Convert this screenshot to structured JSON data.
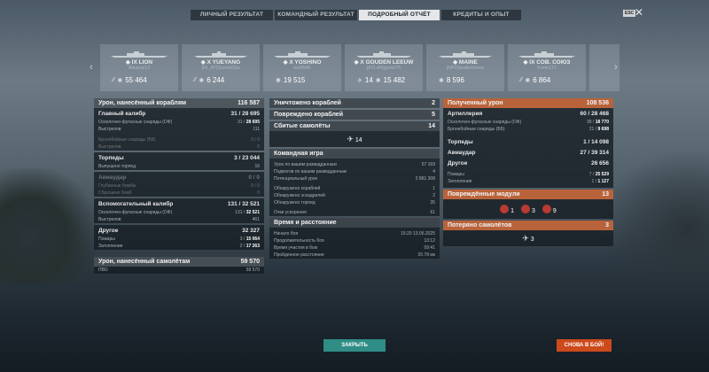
{
  "tabs": [
    {
      "label": "ЛИЧНЫЙ РЕЗУЛЬТАТ",
      "active": false
    },
    {
      "label": "КОМАНДНЫЙ РЕЗУЛЬТАТ",
      "active": false
    },
    {
      "label": "ПОДРОБНЫЙ ОТЧЁТ",
      "active": true
    },
    {
      "label": "КРЕДИТЫ И ОПЫТ",
      "active": false
    }
  ],
  "esc_label": "ESC",
  "ships": [
    {
      "name": "IX LION",
      "player": "Alkazar13",
      "icon": "shell-icon",
      "value": "55 464"
    },
    {
      "name": "X YUEYANG",
      "player": "[W_AT]SionekDja",
      "icon": "shell-icon",
      "value": "6 244"
    },
    {
      "name": "X YOSHINO",
      "player": "wolf546",
      "icon": "shell-icon",
      "value": "19 515"
    },
    {
      "name": "X GOUDEN LEEUW",
      "player": "[ATLAN]golot75",
      "icon": "aircraft-icon",
      "icon_value": "14",
      "value": "15 482"
    },
    {
      "name": "MAINE",
      "player": "[MFD]walterloves",
      "icon": "shell-icon",
      "value": "8 596"
    },
    {
      "name": "IX СОВ. СОЮЗ",
      "player": "Forte117",
      "icon": "shell-icon",
      "value": "6 864"
    }
  ],
  "left": {
    "header": {
      "label": "Урон, нанесённый кораблям",
      "value": "116 587"
    },
    "main_battery": {
      "label": "Главный калибр",
      "value": "31 / 28 695"
    },
    "mb_rows": [
      {
        "label": "Осколочно-фугасные снаряды (ОФ)",
        "v1": "31",
        "v2": "28 695"
      },
      {
        "label": "Выстрелов",
        "v1": "",
        "v2": "111"
      }
    ],
    "mb_ap": [
      {
        "label": "Бронебойные снаряды (ББ)",
        "v1": "0",
        "v2": "0"
      },
      {
        "label": "Выстрелов",
        "v1": "",
        "v2": "0"
      }
    ],
    "torpedoes": {
      "label": "Торпеды",
      "value": "3 / 23 044"
    },
    "torp_rows": [
      {
        "label": "Выпущено торпед",
        "value": "16"
      }
    ],
    "aviation": {
      "label": "Авиаудар",
      "value": "0 / 0"
    },
    "avia_rows": [
      {
        "label": "Глубинные бомбы",
        "value": "0 / 0"
      },
      {
        "label": "Сброшено бомб",
        "value": "0"
      }
    ],
    "secondary": {
      "label": "Вспомогательный калибр",
      "value": "131 / 32 521"
    },
    "sec_rows": [
      {
        "label": "Осколочно-фугасные снаряды (ОФ)",
        "v1": "131",
        "v2": "32 521"
      },
      {
        "label": "Выстрелов",
        "v1": "",
        "v2": "461"
      }
    ],
    "other": {
      "label": "Другое",
      "value": "32 327"
    },
    "other_rows": [
      {
        "label": "Пожары",
        "v1": "3",
        "v2": "15 064"
      },
      {
        "label": "Затопления",
        "v1": "2",
        "v2": "17 263"
      }
    ],
    "planes_header": {
      "label": "Урон, нанесённый самолётам",
      "value": "59 570"
    },
    "aa_row": {
      "label": "ПВО",
      "value": "59 570"
    }
  },
  "middle": {
    "destroyed": {
      "label": "Уничтожено кораблей",
      "value": "2"
    },
    "damaged": {
      "label": "Повреждено кораблей",
      "value": "5"
    },
    "planes_shot": {
      "label": "Сбитые самолёты",
      "value": "14"
    },
    "planes_icon_value": "14",
    "team_header": "Командная игра",
    "team_rows": [
      {
        "label": "Урон по вашим разведданным",
        "value": "57 169"
      },
      {
        "label": "Поджогов по вашим разведданным",
        "value": "4"
      },
      {
        "label": "Потенциальный урон",
        "value": "2 881 308"
      },
      {
        "label": "Обнаружено кораблей",
        "value": "1"
      },
      {
        "label": "Обнаружено эскадрилий",
        "value": "2"
      },
      {
        "label": "Обнаружено торпед",
        "value": "35"
      },
      {
        "label": "Очки ускорения",
        "value": "61"
      }
    ],
    "time_header": "Время и расстояние",
    "time_rows": [
      {
        "label": "Начало боя",
        "value": "15:20  13.05.2025"
      },
      {
        "label": "Продолжительность боя",
        "value": "13:12"
      },
      {
        "label": "Время участия в бою",
        "value": "09:41"
      },
      {
        "label": "Пройденное расстояние",
        "value": "20.78 км"
      }
    ]
  },
  "right": {
    "received": {
      "label": "Полученный урон",
      "value": "108 536"
    },
    "artillery": {
      "label": "Артиллерия",
      "value": "60 / 28 468"
    },
    "art_rows": [
      {
        "label": "Осколочно-фугасные снаряды (ОФ)",
        "v1": "39",
        "v2": "18 770"
      },
      {
        "label": "Бронебойные снаряды (ББ)",
        "v1": "21",
        "v2": "9 698"
      }
    ],
    "torpedoes": {
      "label": "Торпеды",
      "value": "1 / 14 098"
    },
    "aviation": {
      "label": "Авиаудар",
      "value": "27 / 39 314"
    },
    "other": {
      "label": "Другое",
      "value": "26 656"
    },
    "other_rows": [
      {
        "label": "Пожары",
        "v1": "7",
        "v2": "25 529"
      },
      {
        "label": "Затопления",
        "v1": "1",
        "v2": "1 127"
      }
    ],
    "modules": {
      "label": "Повреждённые модули",
      "value": "13"
    },
    "module_counts": [
      "1",
      "3",
      "9"
    ],
    "lost_planes": {
      "label": "Потеряно самолётов",
      "value": "3"
    },
    "lost_icon_value": "3"
  },
  "buttons": {
    "close": "ЗАКРЫТЬ",
    "battle": "СНОВА В БОЙ!"
  },
  "colors": {
    "accent_orange": "#b9633a",
    "close_btn": "#2f8d86",
    "battle_btn": "#cc4a1c"
  }
}
